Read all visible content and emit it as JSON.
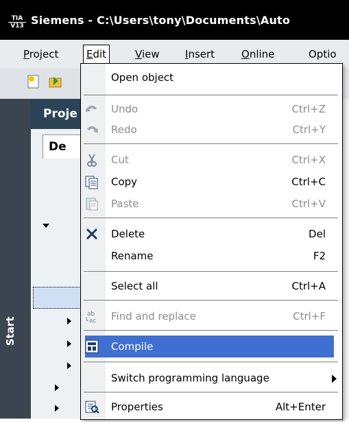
{
  "window": {
    "title": "Siemens  -  C:\\Users\\tony\\Documents\\Auto",
    "logo_text": "TIA V13"
  },
  "menubar": {
    "items": [
      {
        "label": "Project",
        "u": "P",
        "rest": "roject"
      },
      {
        "label": "Edit",
        "u": "E",
        "rest": "dit"
      },
      {
        "label": "View",
        "u": "V",
        "rest": "iew"
      },
      {
        "label": "Insert",
        "u": "I",
        "rest": "nsert"
      },
      {
        "label": "Online",
        "u": "O",
        "rest": "nline"
      },
      {
        "label": "Optio",
        "u": "",
        "rest": "Optio"
      }
    ]
  },
  "leftpanel": {
    "vertical_label": "Start"
  },
  "project_panel": {
    "header": "Proje",
    "tab": "De"
  },
  "edit_menu": {
    "items": [
      {
        "label": "Open object",
        "shortcut": "",
        "enabled": true,
        "icon": "none"
      },
      {
        "label": "Undo",
        "shortcut": "Ctrl+Z",
        "enabled": false,
        "icon": "undo-icon"
      },
      {
        "label": "Redo",
        "shortcut": "Ctrl+Y",
        "enabled": false,
        "icon": "redo-icon"
      },
      {
        "label": "Cut",
        "shortcut": "Ctrl+X",
        "enabled": false,
        "icon": "scissors-icon"
      },
      {
        "label": "Copy",
        "shortcut": "Ctrl+C",
        "enabled": true,
        "icon": "copy-icon"
      },
      {
        "label": "Paste",
        "shortcut": "Ctrl+V",
        "enabled": false,
        "icon": "paste-icon"
      },
      {
        "label": "Delete",
        "shortcut": "Del",
        "enabled": true,
        "icon": "delete-x-icon"
      },
      {
        "label": "Rename",
        "shortcut": "F2",
        "enabled": true,
        "icon": "none"
      },
      {
        "label": "Select all",
        "shortcut": "Ctrl+A",
        "enabled": true,
        "icon": "none"
      },
      {
        "label": "Find and replace",
        "shortcut": "Ctrl+F",
        "enabled": false,
        "icon": "find-replace-icon"
      },
      {
        "label": "Compile",
        "shortcut": "",
        "enabled": true,
        "icon": "compile-icon",
        "highlighted": true
      },
      {
        "label": "Switch programming language",
        "shortcut": "",
        "enabled": true,
        "icon": "none",
        "submenu": true
      },
      {
        "label": "Properties",
        "shortcut": "Alt+Enter",
        "enabled": true,
        "icon": "properties-icon"
      }
    ]
  },
  "colors": {
    "highlight": "#3f6fd0",
    "titlebar": "#000000",
    "menubar": "#e9ecef",
    "disabled_text": "#8d8d8d"
  }
}
